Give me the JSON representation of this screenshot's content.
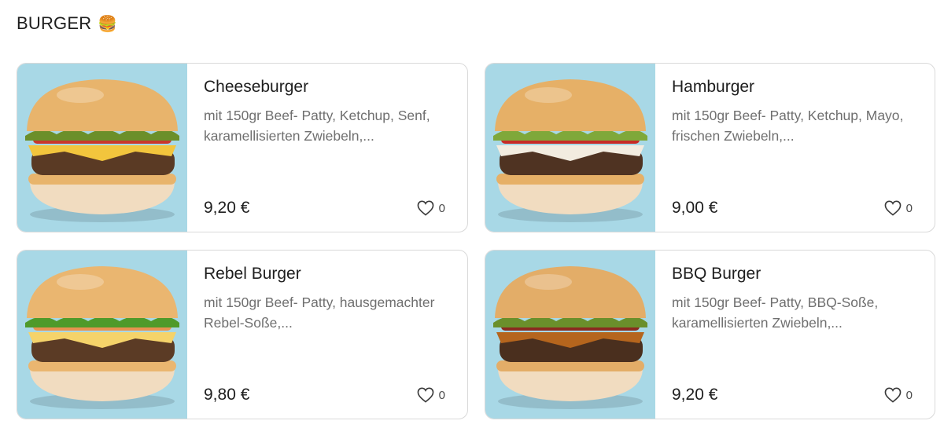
{
  "section": {
    "title": "BURGER",
    "emoji": "🍔"
  },
  "items": [
    {
      "name": "Cheeseburger",
      "description": "mit 150gr Beef- Patty, Ketchup, Senf, karamellisierten Zwiebeln,...",
      "price": "9,20 €",
      "likes": "0",
      "photo": {
        "icon": "cheeseburger-photo",
        "bg": "#a8d8e6",
        "bun": "#e8b46c",
        "cheese": "#f2c53d",
        "veg": "#6b8f2a",
        "sauce": "#c9372c",
        "patty": "#5a3a24"
      }
    },
    {
      "name": "Hamburger",
      "description": "mit 150gr Beef- Patty, Ketchup, Mayo, frischen Zwiebeln,...",
      "price": "9,00 €",
      "likes": "0",
      "photo": {
        "icon": "hamburger-photo",
        "bg": "#a8d8e6",
        "bun": "#e6b067",
        "cheese": "#f2ece0",
        "veg": "#7fa83a",
        "sauce": "#c72b25",
        "patty": "#4f3322"
      }
    },
    {
      "name": "Rebel Burger",
      "description": "mit 150gr Beef- Patty, hausgemachter Rebel-Soße,...",
      "price": "9,80 €",
      "likes": "0",
      "photo": {
        "icon": "rebel-burger-photo",
        "bg": "#a8d8e6",
        "bun": "#eab670",
        "cheese": "#f5d36a",
        "veg": "#4f9a2a",
        "sauce": "#e8924f",
        "patty": "#5b3b25"
      }
    },
    {
      "name": "BBQ Burger",
      "description": "mit 150gr Beef- Patty, BBQ-Soße, karamellisierten Zwiebeln,...",
      "price": "9,20 €",
      "likes": "0",
      "photo": {
        "icon": "bbq-burger-photo",
        "bg": "#a8d8e6",
        "bun": "#e3ad68",
        "cheese": "#b5651d",
        "veg": "#6a8f2b",
        "sauce": "#8a2a1f",
        "patty": "#4a2f1e"
      }
    }
  ]
}
